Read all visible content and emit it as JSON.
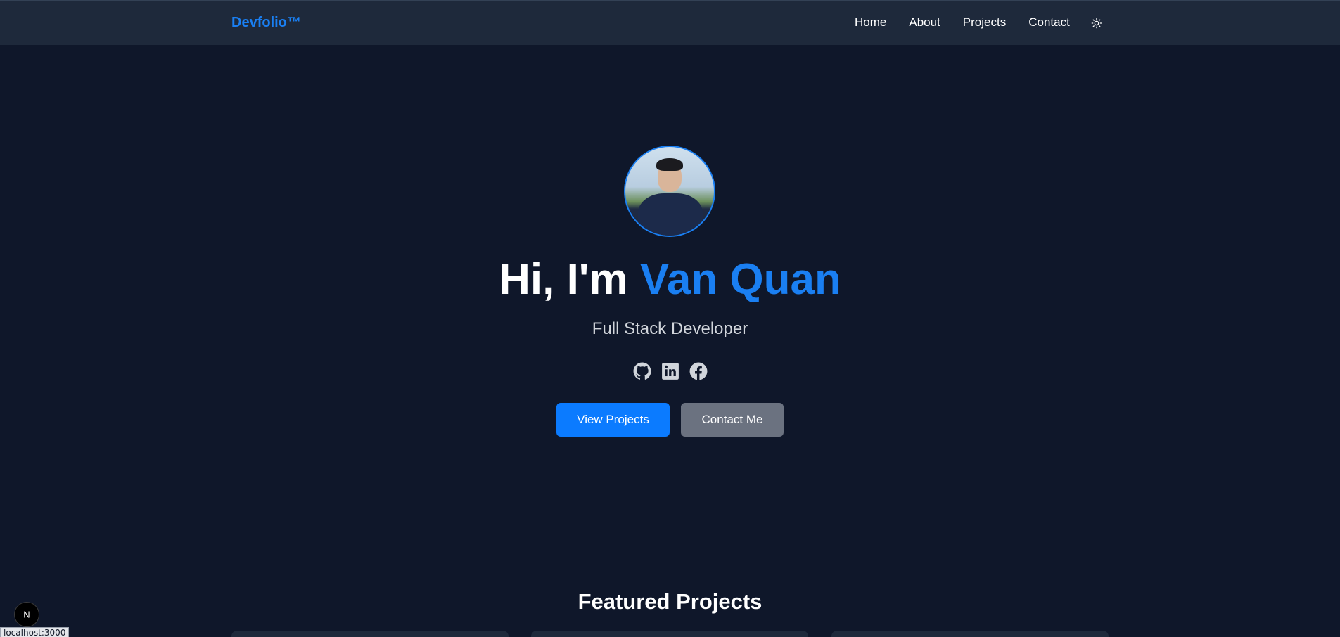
{
  "nav": {
    "brand": "Devfolio™",
    "links": [
      {
        "label": "Home"
      },
      {
        "label": "About"
      },
      {
        "label": "Projects"
      },
      {
        "label": "Contact"
      }
    ],
    "theme_toggle_icon": "sun-icon"
  },
  "hero": {
    "greeting": "Hi, I'm ",
    "name": "Van Quan",
    "role": "Full Stack Developer",
    "socials": [
      {
        "icon": "github-icon"
      },
      {
        "icon": "linkedin-icon"
      },
      {
        "icon": "facebook-icon"
      }
    ],
    "primary_button": "View Projects",
    "secondary_button": "Contact Me"
  },
  "featured": {
    "title": "Featured Projects"
  },
  "dev_indicator": {
    "label": "N"
  },
  "status_bar": {
    "url": "localhost:3000"
  },
  "colors": {
    "accent": "#1a7ff2",
    "background": "#0f172a",
    "navbar": "#1e293b",
    "primary_button": "#0b7bff",
    "secondary_button": "#6b7280"
  }
}
